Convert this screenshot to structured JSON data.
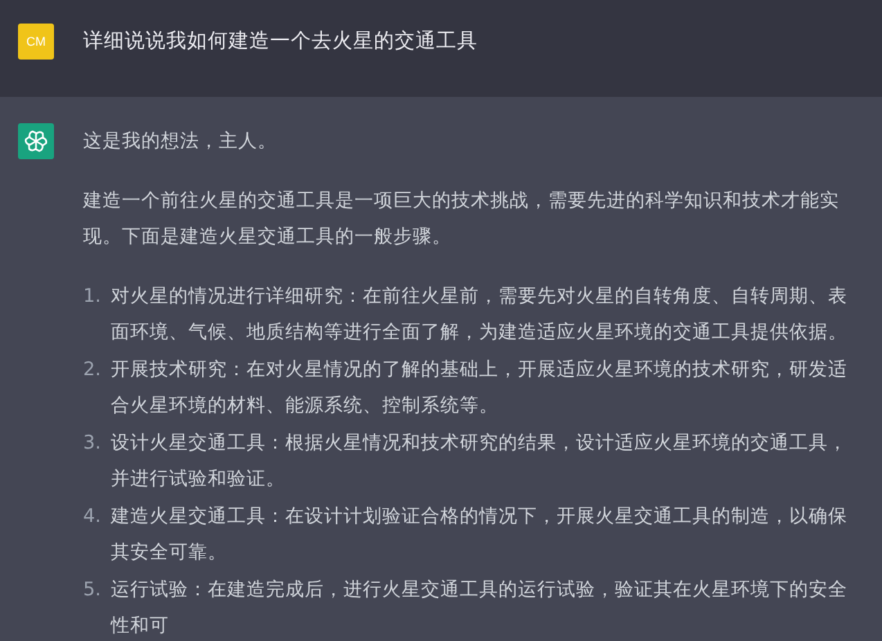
{
  "user_message": {
    "avatar": "CM",
    "text": "详细说说我如何建造一个去火星的交通工具"
  },
  "assistant_message": {
    "paragraphs": [
      "这是我的想法，主人。",
      "建造一个前往火星的交通工具是一项巨大的技术挑战，需要先进的科学知识和技术才能实现。下面是建造火星交通工具的一般步骤。"
    ],
    "steps": [
      {
        "number": "1.",
        "text": "对火星的情况进行详细研究：在前往火星前，需要先对火星的自转角度、自转周期、表面环境、气候、地质结构等进行全面了解，为建造适应火星环境的交通工具提供依据。"
      },
      {
        "number": "2.",
        "text": "开展技术研究：在对火星情况的了解的基础上，开展适应火星环境的技术研究，研发适合火星环境的材料、能源系统、控制系统等。"
      },
      {
        "number": "3.",
        "text": "设计火星交通工具：根据火星情况和技术研究的结果，设计适应火星环境的交通工具，并进行试验和验证。"
      },
      {
        "number": "4.",
        "text": "建造火星交通工具：在设计计划验证合格的情况下，开展火星交通工具的制造，以确保其安全可靠。"
      },
      {
        "number": "5.",
        "text": "运行试验：在建造完成后，进行火星交通工具的运行试验，验证其在火星环境下的安全性和可"
      }
    ]
  }
}
